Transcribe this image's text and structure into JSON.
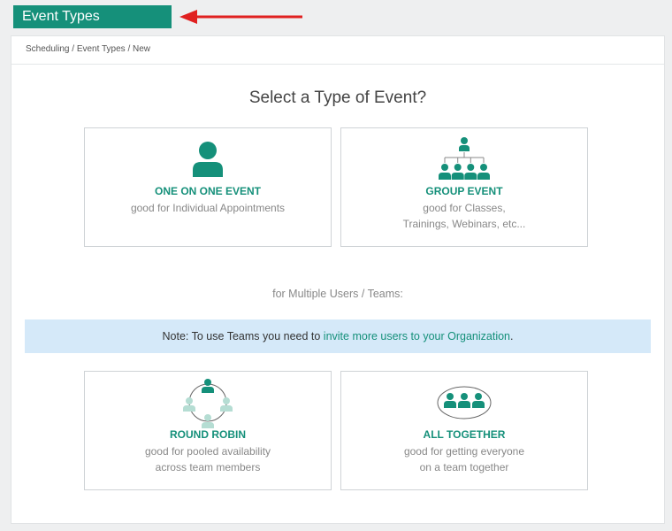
{
  "header": {
    "title": "Event Types"
  },
  "breadcrumb": "Scheduling / Event Types / New",
  "page_title": "Select a Type of Event?",
  "cards": {
    "one_on_one": {
      "title": "ONE ON ONE EVENT",
      "desc": "good for Individual Appointments"
    },
    "group": {
      "title": "GROUP EVENT",
      "desc_line1": "good for Classes,",
      "desc_line2": "Trainings, Webinars, etc..."
    },
    "round_robin": {
      "title": "ROUND ROBIN",
      "desc_line1": "good for pooled availability",
      "desc_line2": "across team members"
    },
    "all_together": {
      "title": "ALL TOGETHER",
      "desc_line1": "good for getting everyone",
      "desc_line2": "on a team together"
    }
  },
  "teams_subtitle": "for Multiple Users / Teams:",
  "note": {
    "prefix": "Note: To use Teams you need to ",
    "link": "invite more users to your Organization",
    "suffix": "."
  },
  "colors": {
    "brand": "#15907a",
    "note_bg": "#d5e9f9",
    "arrow": "#e02020"
  },
  "icons": {
    "one_on_one": "person-icon",
    "group": "org-chart-icon",
    "round_robin": "round-robin-icon",
    "all_together": "team-group-icon"
  }
}
